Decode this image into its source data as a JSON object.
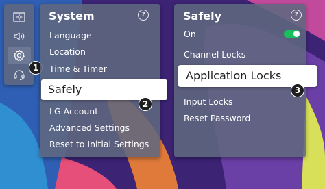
{
  "sidebar": {
    "icons": [
      "picture-icon",
      "sound-icon",
      "settings-gear-icon",
      "support-icon"
    ],
    "active": "settings-gear-icon"
  },
  "system_menu": {
    "title": "System",
    "help": "?",
    "items": [
      "Language",
      "Location",
      "Time & Timer",
      "Safely",
      "LG Account",
      "Advanced Settings",
      "Reset to Initial Settings"
    ],
    "selected": "Safely"
  },
  "safely_menu": {
    "title": "Safely",
    "help": "?",
    "on_label": "On",
    "toggle_state": "on",
    "items": [
      "Channel Locks",
      "Application Locks",
      "Input Locks",
      "Reset Password"
    ],
    "selected": "Application Locks"
  },
  "steps": [
    "1",
    "2",
    "3"
  ],
  "colors": {
    "toggle_on": "#17c05a",
    "panel": "#606880",
    "selected_bg": "#ffffff"
  }
}
